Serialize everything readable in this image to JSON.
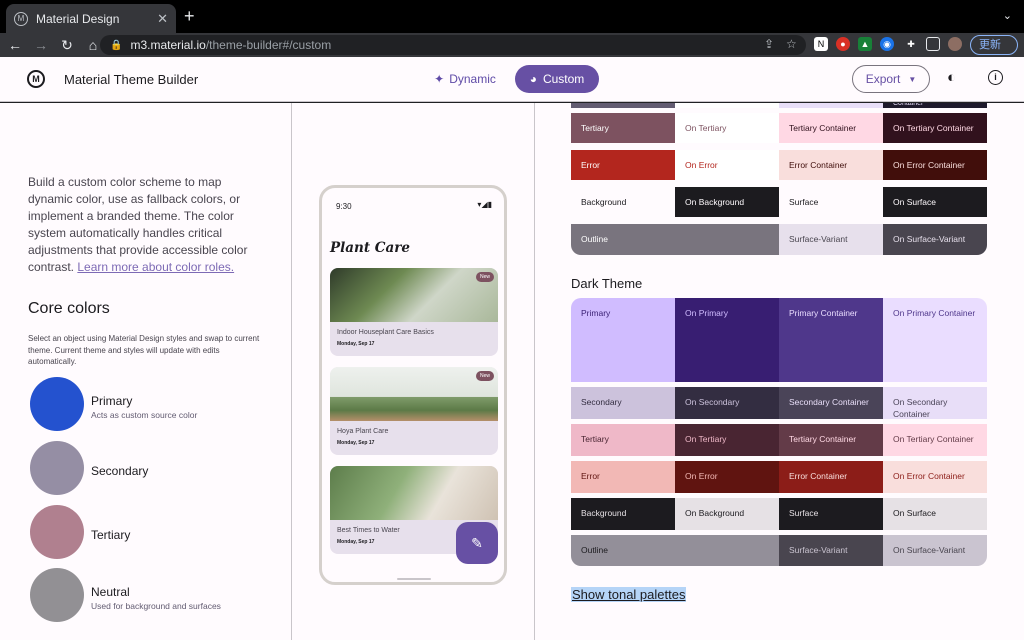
{
  "browser": {
    "tab_title": "Material Design",
    "tab_close": "✕",
    "new_tab": "+",
    "url_host": "m3.material.io",
    "url_path": "/theme-builder#/custom",
    "update_label": "更新"
  },
  "header": {
    "logo": "M",
    "app_title": "Material Theme Builder",
    "nav_dynamic": "Dynamic",
    "nav_custom": "Custom",
    "export_label": "Export"
  },
  "left": {
    "intro": "Build a custom color scheme to map dynamic color, use as fallback colors, or implement a branded theme. The color system automatically handles critical adjustments that provide accessible color contrast. ",
    "learn_link": "Learn more about color roles.",
    "core_title": "Core colors",
    "core_desc": "Select an object using Material Design styles and swap to current theme. Current theme and styles will update with edits automatically.",
    "core_colors": [
      {
        "name": "Primary",
        "sub": "Acts as custom source color",
        "color": "#2452cf"
      },
      {
        "name": "Secondary",
        "sub": "",
        "color": "#958ea4"
      },
      {
        "name": "Tertiary",
        "sub": "",
        "color": "#b0808f"
      },
      {
        "name": "Neutral",
        "sub": "Used for background and surfaces",
        "color": "#929094"
      }
    ]
  },
  "phone": {
    "time": "9:30",
    "status_icons": "▾◢▮",
    "app_title": "Plant Care",
    "cards": [
      {
        "title": "Indoor Houseplant Care Basics",
        "date": "Monday, Sep 17",
        "badge": "New"
      },
      {
        "title": "Hoya Plant Care",
        "date": "Monday, Sep 17",
        "badge": "New"
      },
      {
        "title": "Best Times to Water",
        "date": "Monday, Sep 17",
        "badge": ""
      }
    ]
  },
  "light_theme": {
    "top_partial": [
      {
        "label": "",
        "bg": "#625b71",
        "fg": "#ffffff"
      },
      {
        "label": "",
        "bg": "#ffffff",
        "fg": "#625b71"
      },
      {
        "label": "",
        "bg": "#e8def8",
        "fg": "#1d192b"
      },
      {
        "label": "Container",
        "bg": "#1d192b",
        "fg": "#e8def8"
      }
    ],
    "rows": [
      [
        {
          "label": "Tertiary",
          "bg": "#7d5260",
          "fg": "#ffffff"
        },
        {
          "label": "On Tertiary",
          "bg": "#ffffff",
          "fg": "#7d5260"
        },
        {
          "label": "Tertiary Container",
          "bg": "#ffd8e4",
          "fg": "#31111d"
        },
        {
          "label": "On Tertiary Container",
          "bg": "#31111d",
          "fg": "#ffd8e4"
        }
      ],
      [
        {
          "label": "Error",
          "bg": "#b3261e",
          "fg": "#ffffff"
        },
        {
          "label": "On Error",
          "bg": "#ffffff",
          "fg": "#b3261e"
        },
        {
          "label": "Error Container",
          "bg": "#f9dedc",
          "fg": "#410e0b"
        },
        {
          "label": "On Error Container",
          "bg": "#410e0b",
          "fg": "#f9dedc"
        }
      ],
      [
        {
          "label": "Background",
          "bg": "#fffbfe",
          "fg": "#1c1b1f"
        },
        {
          "label": "On Background",
          "bg": "#1c1b1f",
          "fg": "#fffbfe"
        },
        {
          "label": "Surface",
          "bg": "#fffbfe",
          "fg": "#1c1b1f"
        },
        {
          "label": "On Surface",
          "bg": "#1c1b1f",
          "fg": "#fffbfe"
        }
      ]
    ],
    "outline_row": [
      {
        "label": "Outline",
        "bg": "#79747e",
        "fg": "#ffffff"
      },
      {
        "label": "Surface-Variant",
        "bg": "#e7e0ec",
        "fg": "#49454f"
      },
      {
        "label": "On Surface-Variant",
        "bg": "#49454f",
        "fg": "#e7e0ec"
      }
    ]
  },
  "dark_theme": {
    "title": "Dark Theme",
    "primary_row": [
      {
        "label": "Primary",
        "bg": "#d0bcff",
        "fg": "#381e72"
      },
      {
        "label": "On Primary",
        "bg": "#381e72",
        "fg": "#d0bcff"
      },
      {
        "label": "Primary Container",
        "bg": "#4f378b",
        "fg": "#eaddff"
      },
      {
        "label": "On Primary Container",
        "bg": "#eaddff",
        "fg": "#4f378b"
      }
    ],
    "rows": [
      [
        {
          "label": "Secondary",
          "bg": "#ccc2dc",
          "fg": "#332d41"
        },
        {
          "label": "On Secondary",
          "bg": "#332d41",
          "fg": "#ccc2dc"
        },
        {
          "label": "Secondary Container",
          "bg": "#4a4458",
          "fg": "#e8def8"
        },
        {
          "label": "On Secondary Container",
          "bg": "#e8def8",
          "fg": "#4a4458"
        }
      ],
      [
        {
          "label": "Tertiary",
          "bg": "#efb8c8",
          "fg": "#492532"
        },
        {
          "label": "On Tertiary",
          "bg": "#492532",
          "fg": "#efb8c8"
        },
        {
          "label": "Tertiary Container",
          "bg": "#633b48",
          "fg": "#ffd8e4"
        },
        {
          "label": "On Tertiary Container",
          "bg": "#ffd8e4",
          "fg": "#633b48"
        }
      ],
      [
        {
          "label": "Error",
          "bg": "#f2b8b5",
          "fg": "#601410"
        },
        {
          "label": "On Error",
          "bg": "#601410",
          "fg": "#f2b8b5"
        },
        {
          "label": "Error Container",
          "bg": "#8c1d18",
          "fg": "#f9dedc"
        },
        {
          "label": "On Error Container",
          "bg": "#f9dedc",
          "fg": "#8c1d18"
        }
      ],
      [
        {
          "label": "Background",
          "bg": "#1c1b1f",
          "fg": "#e6e1e5"
        },
        {
          "label": "On Background",
          "bg": "#e6e1e5",
          "fg": "#1c1b1f"
        },
        {
          "label": "Surface",
          "bg": "#1c1b1f",
          "fg": "#e6e1e5"
        },
        {
          "label": "On Surface",
          "bg": "#e6e1e5",
          "fg": "#1c1b1f"
        }
      ]
    ],
    "outline_row": [
      {
        "label": "Outline",
        "bg": "#938f99",
        "fg": "#1c1b1f"
      },
      {
        "label": "Surface-Variant",
        "bg": "#49454f",
        "fg": "#cac4d0"
      },
      {
        "label": "On Surface-Variant",
        "bg": "#cac4d0",
        "fg": "#49454f"
      }
    ]
  },
  "tonal_link": "Show tonal palettes",
  "colors": {
    "accent": "#6750a4",
    "accent_text": "#5f4ba7"
  }
}
